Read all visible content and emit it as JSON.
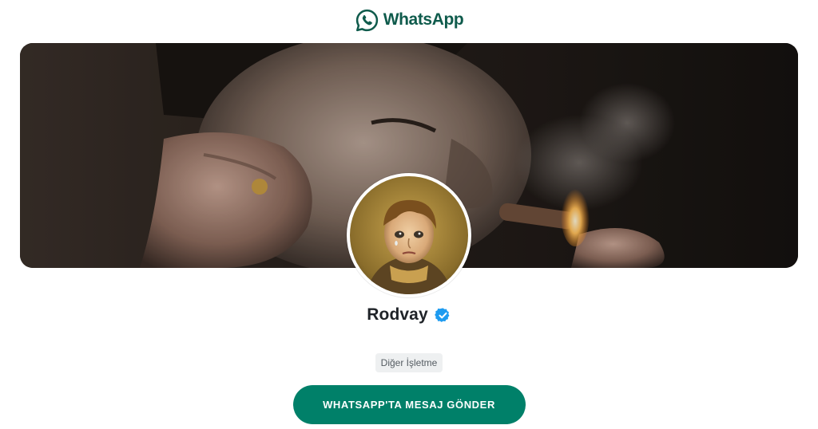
{
  "header": {
    "brand_name": "WhatsApp",
    "brand_color": "#0f5b4c",
    "logo_icon": "whatsapp-phone-bubble-icon"
  },
  "cover": {
    "image_description_icon": "cover-photo"
  },
  "profile": {
    "name": "Rodvay",
    "verified": true,
    "verified_icon": "verified-badge-icon",
    "verified_color": "#1d9bf0",
    "category": "Diğer İşletme"
  },
  "cta": {
    "label": "WHATSAPP'TA MESAJ GÖNDER",
    "color": "#008069"
  }
}
